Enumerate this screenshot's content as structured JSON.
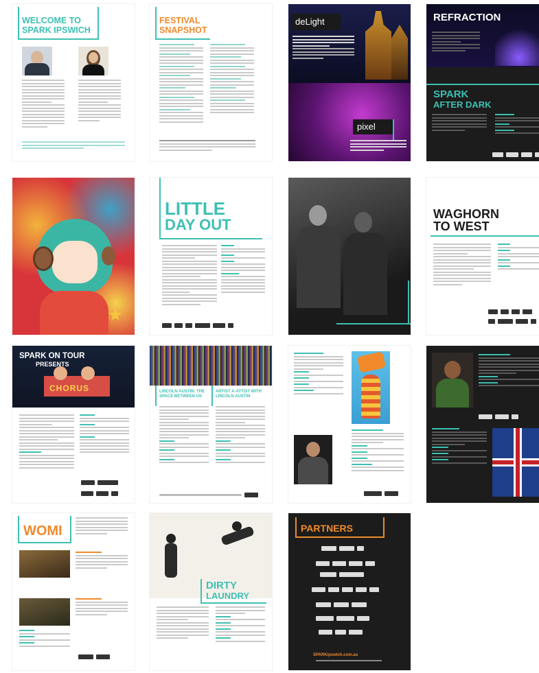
{
  "colors": {
    "teal": "#3dc0b3",
    "orange": "#f08a2b",
    "dark": "#1c1c1c",
    "purple": "#6b1f7a"
  },
  "pages": {
    "welcome": {
      "title_line1": "WELCOME TO",
      "title_line2": "SPARK IPSWICH"
    },
    "snapshot": {
      "title_line1": "FESTIVAL",
      "title_line2": "SNAPSHOT"
    },
    "delight": {
      "title": "deLight",
      "pixel_title": "pixel"
    },
    "refraction": {
      "title": "REFRACTION",
      "after_dark_line1": "SPARK",
      "after_dark_line2": "AFTER DARK"
    },
    "little_day_out": {
      "title_line1": "LITTLE",
      "title_line2": "DAY OUT"
    },
    "performers": {},
    "waghorn": {
      "title_line1": "WAGHORN",
      "title_line2": "TO WEST"
    },
    "spark_on_tour": {
      "title_line1": "SPARK ON TOUR",
      "title_line2": "PRESENTS",
      "sign": "CHORUS"
    },
    "lincoln": {
      "heading_left": "LINCOLN AUSTIN: THE SPACE BETWEEN US",
      "heading_right": "ARTIST A-ATTIST WITH LINCOLN AUSTIN"
    },
    "womi": {
      "title": "WOMI"
    },
    "dirty_laundry": {
      "title_line1": "DIRTY",
      "title_line2": "LAUNDRY"
    },
    "partners": {
      "title": "PARTNERS",
      "url": "SPARKipswich.com.au"
    }
  }
}
